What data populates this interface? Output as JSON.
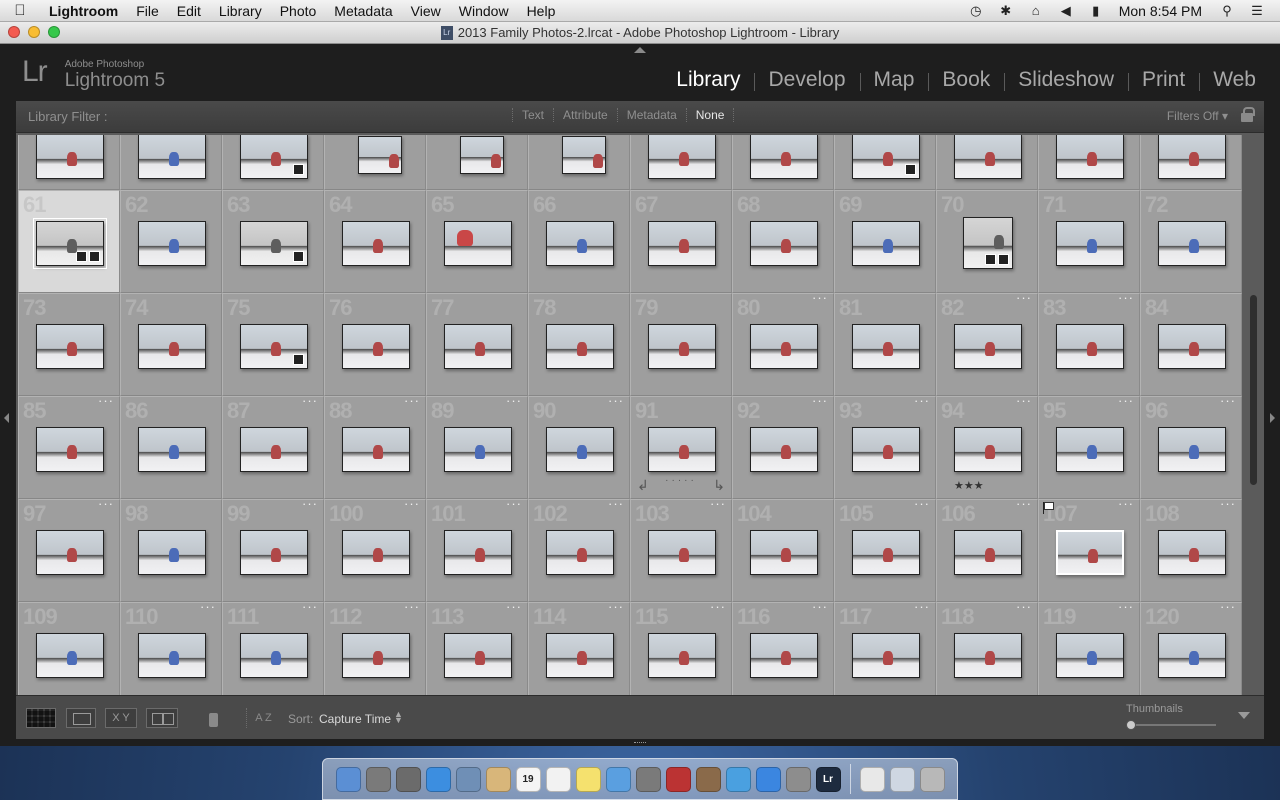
{
  "menubar": {
    "app": "Lightroom",
    "items": [
      "File",
      "Edit",
      "Library",
      "Photo",
      "Metadata",
      "View",
      "Window",
      "Help"
    ],
    "clock": "Mon 8:54 PM",
    "status_icons": [
      "time-machine-icon",
      "bluetooth-icon",
      "wifi-icon",
      "volume-icon",
      "battery-icon",
      "spotlight-icon",
      "notification-icon"
    ]
  },
  "window": {
    "title": "2013 Family Photos-2.lrcat - Adobe Photoshop Lightroom - Library",
    "doc_icon_text": "Lr"
  },
  "identity": {
    "logo": "Lr",
    "brand_small": "Adobe Photoshop",
    "brand_big": "Lightroom 5"
  },
  "modules": [
    "Library",
    "Develop",
    "Map",
    "Book",
    "Slideshow",
    "Print",
    "Web"
  ],
  "active_module": "Library",
  "filter": {
    "label": "Library Filter :",
    "options": [
      "Text",
      "Attribute",
      "Metadata",
      "None"
    ],
    "active": "None",
    "status": "Filters Off"
  },
  "grid": {
    "top_row_numbers": [
      "",
      "",
      "",
      "",
      "",
      "",
      "",
      "",
      "",
      "",
      "",
      ""
    ],
    "rows": [
      [
        "61",
        "62",
        "63",
        "64",
        "65",
        "66",
        "67",
        "68",
        "69",
        "70",
        "71",
        "72"
      ],
      [
        "73",
        "74",
        "75",
        "76",
        "77",
        "78",
        "79",
        "80",
        "81",
        "82",
        "83",
        "84"
      ],
      [
        "85",
        "86",
        "87",
        "88",
        "89",
        "90",
        "91",
        "92",
        "93",
        "94",
        "95",
        "96"
      ],
      [
        "97",
        "98",
        "99",
        "100",
        "101",
        "102",
        "103",
        "104",
        "105",
        "106",
        "107",
        "108"
      ],
      [
        "109",
        "110",
        "111",
        "112",
        "113",
        "114",
        "115",
        "116",
        "117",
        "118",
        "119",
        "120"
      ]
    ],
    "selected": "61",
    "hovered": "91",
    "rating_94": "★★★",
    "dots": "···"
  },
  "toolbar": {
    "xy_label": "X Y",
    "az_label": "A Z",
    "sort_label": "Sort:",
    "sort_value": "Capture Time",
    "thumbnails_label": "Thumbnails",
    "thumbnail_size": 0.0
  },
  "dock": {
    "calendar_day": "19",
    "items": [
      "finder-icon",
      "launchpad-icon",
      "mission-control-icon",
      "safari-icon",
      "preview-icon",
      "contacts-icon",
      "calendar-icon",
      "notes-icon",
      "stickies-icon",
      "messages-icon",
      "facetime-icon",
      "photo-booth-icon",
      "iphoto-icon",
      "itunes-icon",
      "app-store-icon",
      "system-preferences-icon",
      "lightroom-icon",
      "documents-icon",
      "downloads-icon",
      "trash-icon"
    ]
  }
}
